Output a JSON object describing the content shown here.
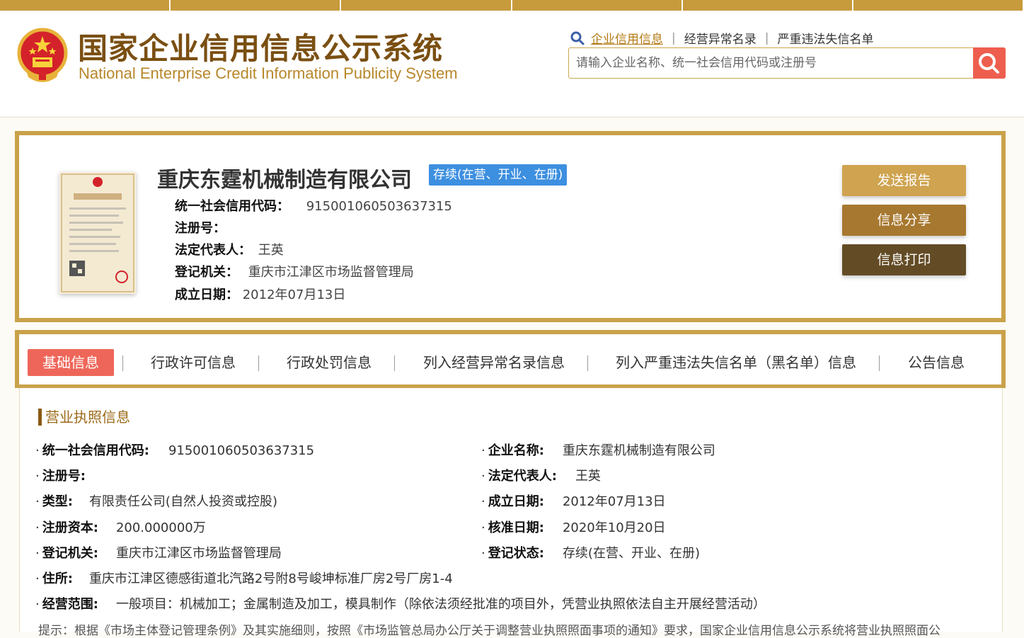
{
  "site": {
    "title_cn": "国家企业信用信息公示系统",
    "title_en": "National Enterprise Credit Information Publicity System"
  },
  "topnav": {
    "items": [
      "企业信用信息",
      "经营异常名录",
      "严重违法失信名单"
    ],
    "sep": "|"
  },
  "search": {
    "placeholder": "请输入企业名称、统一社会信用代码或注册号",
    "value": ""
  },
  "company": {
    "name": "重庆东霆机械制造有限公司",
    "status_badge": "存续(在营、开业、在册)",
    "fields": [
      {
        "label": "统一社会信用代码：",
        "value": "915001060503637315"
      },
      {
        "label": "注册号：",
        "value": ""
      },
      {
        "label": "法定代表人：",
        "value": "王英"
      },
      {
        "label": "登记机关：",
        "value": "重庆市江津区市场监督管理局"
      },
      {
        "label": "成立日期：",
        "value": "2012年07月13日"
      }
    ]
  },
  "actions": {
    "send_report": "发送报告",
    "share": "信息分享",
    "print": "信息打印"
  },
  "tabs": [
    "基础信息",
    "行政许可信息",
    "行政处罚信息",
    "列入经营异常名录信息",
    "列入严重违法失信名单（黑名单）信息",
    "公告信息"
  ],
  "tab_sep": "|",
  "license": {
    "section_title": "营业执照信息",
    "bullet": "·",
    "left": [
      {
        "label": "统一社会信用代码:",
        "value": "915001060503637315"
      },
      {
        "label": "注册号:",
        "value": ""
      },
      {
        "label": "类型:",
        "value": "有限责任公司(自然人投资或控股)"
      },
      {
        "label": "注册资本:",
        "value": "200.000000万"
      },
      {
        "label": "登记机关:",
        "value": "重庆市江津区市场监督管理局"
      },
      {
        "label": "住所:",
        "value": "重庆市江津区德感街道北汽路2号附8号峻坤标准厂房2号厂房1-4"
      },
      {
        "label": "经营范围:",
        "value": "一般项目：机械加工；金属制造及加工，模具制作（除依法须经批准的项目外，凭营业执照依法自主开展经营活动）"
      }
    ],
    "right": [
      {
        "label": "企业名称:",
        "value": "重庆东霆机械制造有限公司"
      },
      {
        "label": "法定代表人:",
        "value": "王英"
      },
      {
        "label": "成立日期:",
        "value": "2012年07月13日"
      },
      {
        "label": "核准日期:",
        "value": "2020年10月20日"
      },
      {
        "label": "登记状态:",
        "value": "存续(在营、开业、在册)"
      }
    ],
    "hint": "提示：根据《市场主体登记管理条例》及其实施细则，按照《市场监管总局办公厅关于调整营业执照照面事项的通知》要求，国家企业信用信息公示系统将营业执照照面公"
  },
  "colors": {
    "gold_border": "#c9a24a",
    "brand_brown": "#7a4f12",
    "badge_blue": "#3d8fe0",
    "active_tab_red": "#ee6659",
    "search_red": "#ee5e4f"
  },
  "icons": {
    "search_small": "magnifier-icon",
    "search_button": "magnifier-icon",
    "emblem": "national-emblem-icon",
    "license": "business-license-image"
  }
}
